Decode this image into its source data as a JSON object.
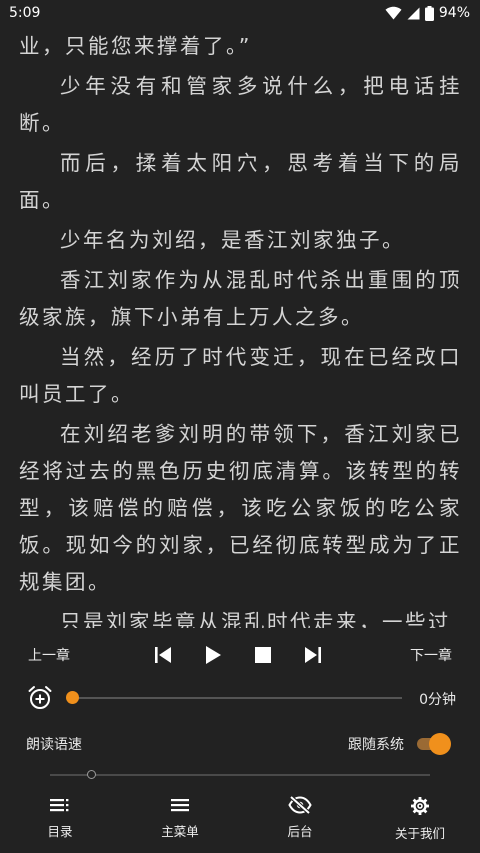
{
  "status": {
    "time": "5:09",
    "battery": "94%"
  },
  "reader": {
    "paragraphs": [
      {
        "text": "业，只能您来撑着了。”",
        "indent": false
      },
      {
        "text": "少年没有和管家多说什么，把电话挂断。",
        "indent": true
      },
      {
        "text": "而后，揉着太阳穴，思考着当下的局面。",
        "indent": true
      },
      {
        "text": "少年名为刘绍，是香江刘家独子。",
        "indent": true
      },
      {
        "text": "香江刘家作为从混乱时代杀出重围的顶级家族，旗下小弟有上万人之多。",
        "indent": true
      },
      {
        "text": "当然，经历了时代变迁，现在已经改口叫员工了。",
        "indent": true
      },
      {
        "text": "在刘绍老爹刘明的带领下，香江刘家已经将过去的黑色历史彻底清算。该转型的转型，该赔偿的赔偿，该吃公家饭的吃公家饭。现如今的刘家，已经彻底转型成为了正规集团。",
        "indent": true
      },
      {
        "text": "只是刘家毕竟从混乱时代走来，一些过",
        "indent": true
      }
    ]
  },
  "panel": {
    "prev_chapter": "上一章",
    "next_chapter": "下一章",
    "timer": {
      "value_label": "0分钟",
      "fraction": 0
    },
    "speed_label": "朗读语速",
    "follow_system_label": "跟随系统",
    "follow_system_on": true,
    "speed_fraction": 0.11
  },
  "bottom_nav": [
    {
      "label": "目录",
      "icon": "catalog-icon"
    },
    {
      "label": "主菜单",
      "icon": "menu-icon"
    },
    {
      "label": "后台",
      "icon": "eye-off-icon"
    },
    {
      "label": "关于我们",
      "icon": "gear-icon"
    }
  ],
  "colors": {
    "accent": "#f0901c",
    "background": "#222222",
    "text": "#d4d4d4"
  }
}
